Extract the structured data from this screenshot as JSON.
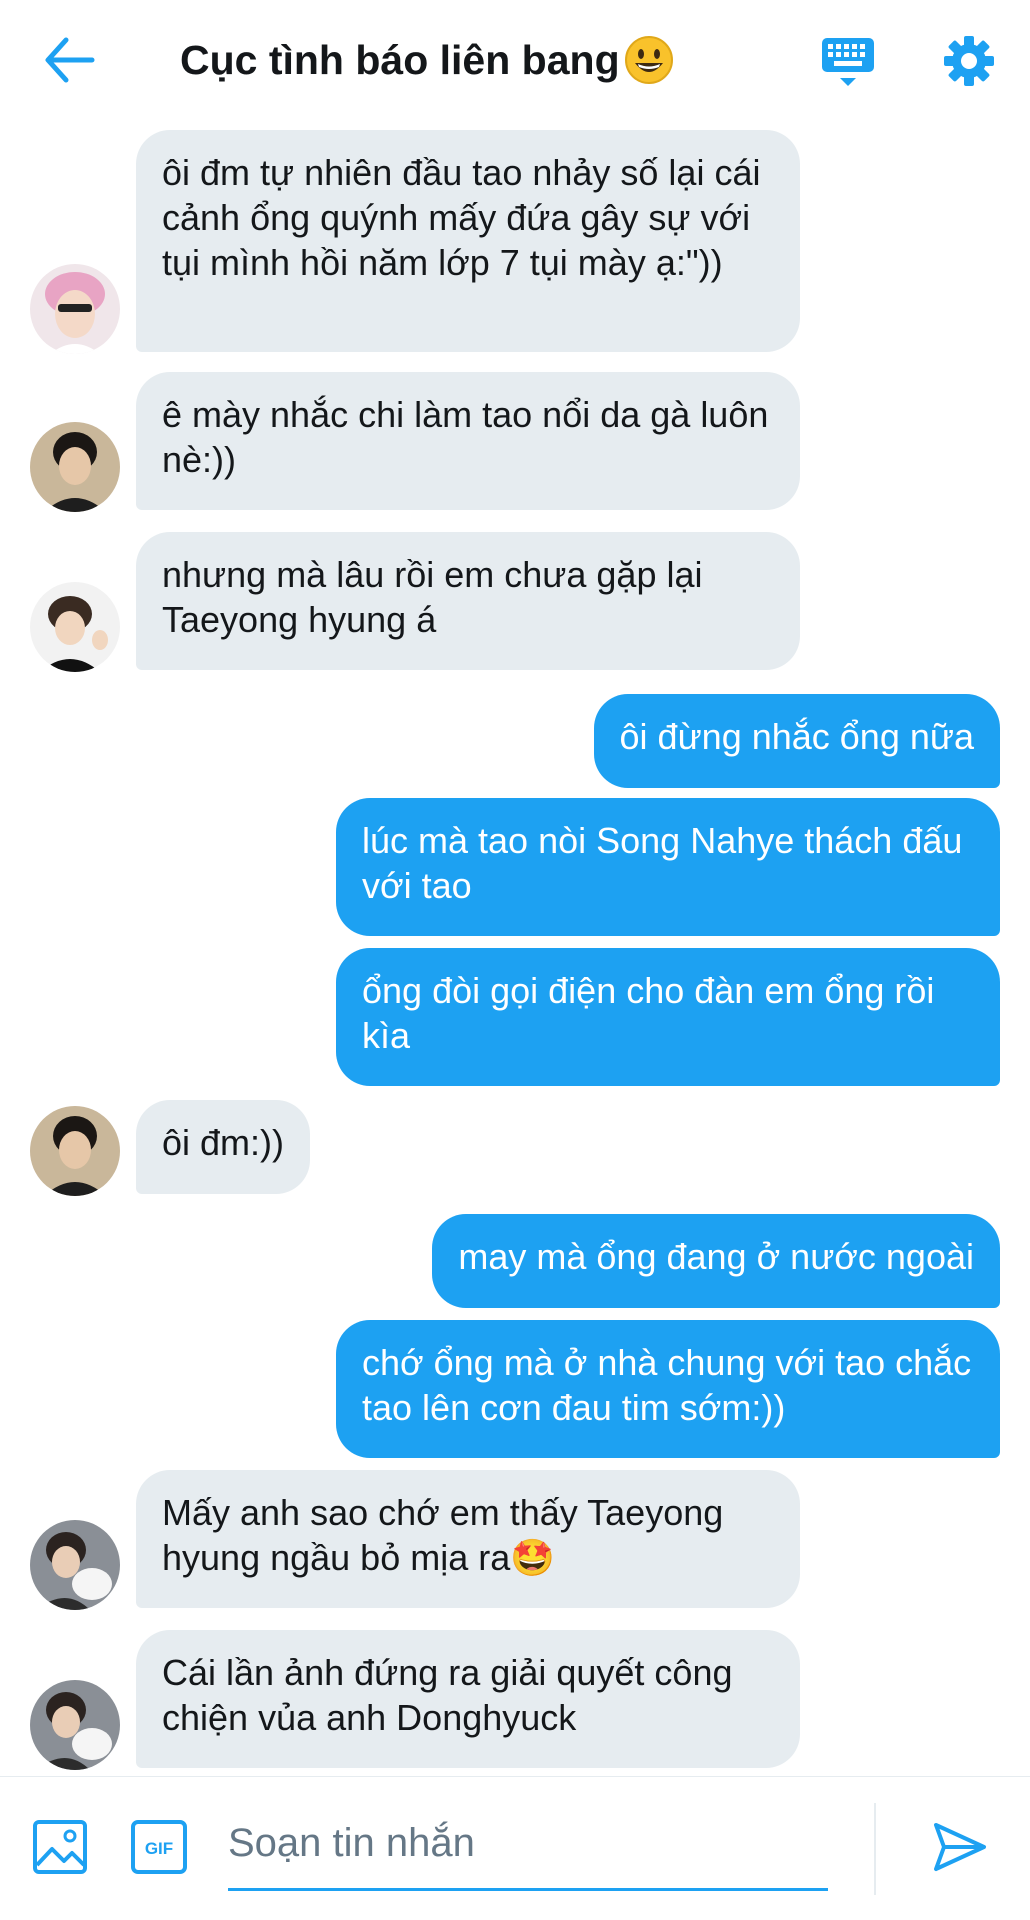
{
  "header": {
    "title": "Cục tình báo liên bang",
    "title_emoji_icon": "grinning-face-icon",
    "accent": "#1da1f2"
  },
  "messages": [
    {
      "side": "in",
      "avatar": "pink-hair-avatar",
      "text": "ôi đm tự nhiên đầu tao nhảy số lại cái cảnh ổng quýnh mấy đứa gây sự với tụi mình hồi năm lớp 7 tụi mày ạ:\"))"
    },
    {
      "side": "in",
      "avatar": "dark-hair-avatar",
      "text": "ê mày nhắc chi làm tao nổi da gà luôn nè:))"
    },
    {
      "side": "in",
      "avatar": "peace-sign-avatar",
      "text": "nhưng mà lâu rồi em chưa gặp lại Taeyong hyung á"
    },
    {
      "side": "out",
      "text": "ôi đừng nhắc ổng nữa"
    },
    {
      "side": "out",
      "text": "lúc mà tao nòi Song Nahye thách đấu với tao"
    },
    {
      "side": "out",
      "text": "ổng đòi gọi điện cho đàn em ổng rồi kìa"
    },
    {
      "side": "in",
      "avatar": "dark-hair-avatar",
      "text": "ôi đm:))"
    },
    {
      "side": "out",
      "text": "may mà ổng đang ở nước ngoài"
    },
    {
      "side": "out",
      "text": "chớ ổng mà ở nhà chung với tao chắc tao lên cơn đau tim sớm:))"
    },
    {
      "side": "in",
      "avatar": "puppy-avatar",
      "text": "Mấy anh sao chớ em thấy Taeyong hyung ngầu bỏ mịa ra🤩"
    },
    {
      "side": "in",
      "avatar": "puppy-avatar",
      "text": "Cái lần ảnh đứng ra giải quyết công chiện vủa anh Donghyuck"
    }
  ],
  "composer": {
    "placeholder": "Soạn tin nhắn",
    "gif_label": "GIF"
  }
}
